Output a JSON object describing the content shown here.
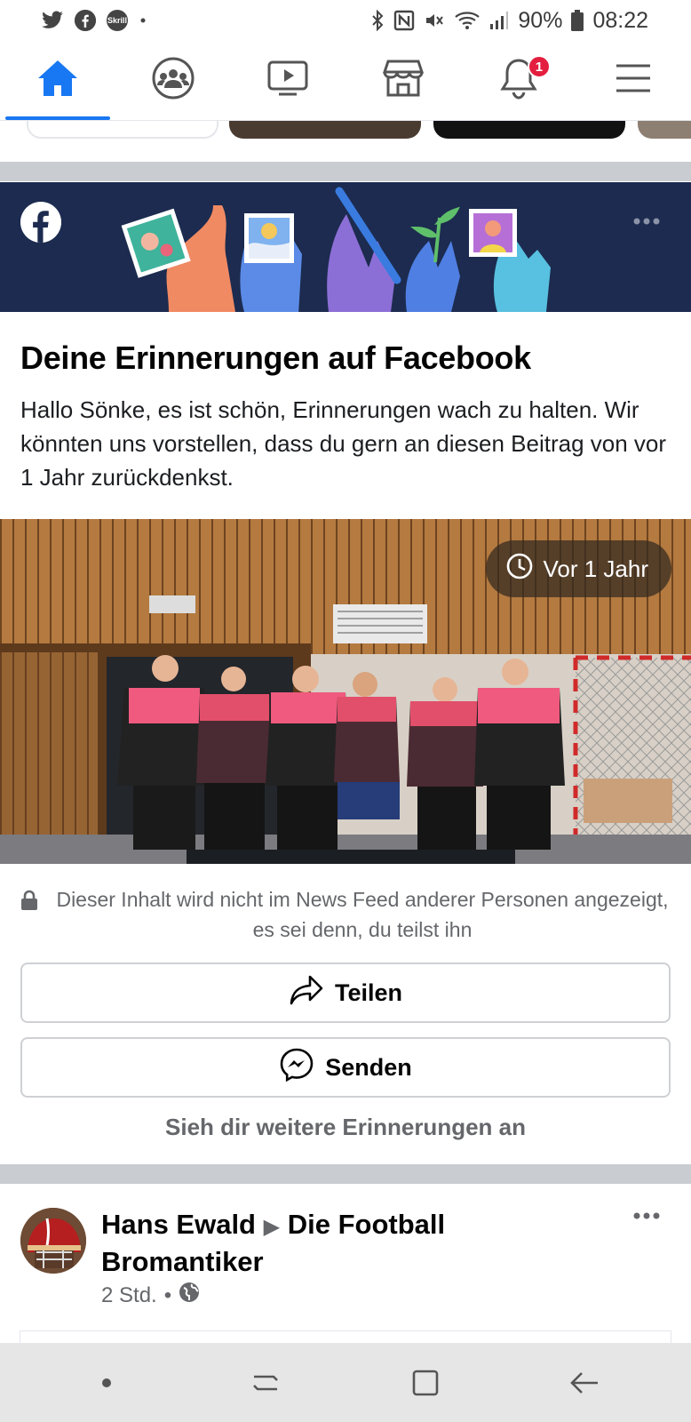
{
  "status_bar": {
    "left_icons": [
      "twitter-icon",
      "facebook-icon",
      "skrill-icon",
      "dot-icon"
    ],
    "skrill_label": "Skrill",
    "right_icons": [
      "bluetooth-icon",
      "nfc-icon",
      "mute-icon",
      "wifi-icon",
      "signal-icon"
    ],
    "battery": "90%",
    "time": "08:22"
  },
  "navbar": {
    "tabs": [
      {
        "name": "home",
        "icon": "home-icon",
        "active": true
      },
      {
        "name": "groups",
        "icon": "groups-icon",
        "active": false
      },
      {
        "name": "watch",
        "icon": "video-icon",
        "active": false
      },
      {
        "name": "marketplace",
        "icon": "store-icon",
        "active": false
      },
      {
        "name": "notifications",
        "icon": "bell-icon",
        "active": false
      },
      {
        "name": "menu",
        "icon": "hamburger-icon",
        "active": false
      }
    ],
    "notification_count": "1",
    "accent": "#1877f2",
    "badge_color": "#e41e3f"
  },
  "memory_card": {
    "banner_color": "#1c2b4f",
    "title": "Deine Erinnerungen auf Facebook",
    "text": "Hallo Sönke, es ist schön, Erinnerungen wach zu halten. Wir könnten uns vorstellen, dass du gern an diesen Beitrag von vor 1 Jahr zurückdenkst.",
    "time_pill": "Vor 1 Jahr",
    "privacy_text": "Dieser Inhalt wird nicht im News Feed anderer Personen angezeigt, es sei denn, du teilst ihn",
    "share_label": "Teilen",
    "send_label": "Senden",
    "see_more_label": "Sieh dir weitere Erinnerungen an"
  },
  "post": {
    "author": "Hans Ewald",
    "separator": "▶",
    "group": "Die Football Bromantiker",
    "time": "2 Std.",
    "dot": "•",
    "audience_icon": "globe-icon"
  },
  "system_nav": {
    "buttons": [
      "dot-icon",
      "recents-icon",
      "home-square-icon",
      "back-icon"
    ]
  }
}
